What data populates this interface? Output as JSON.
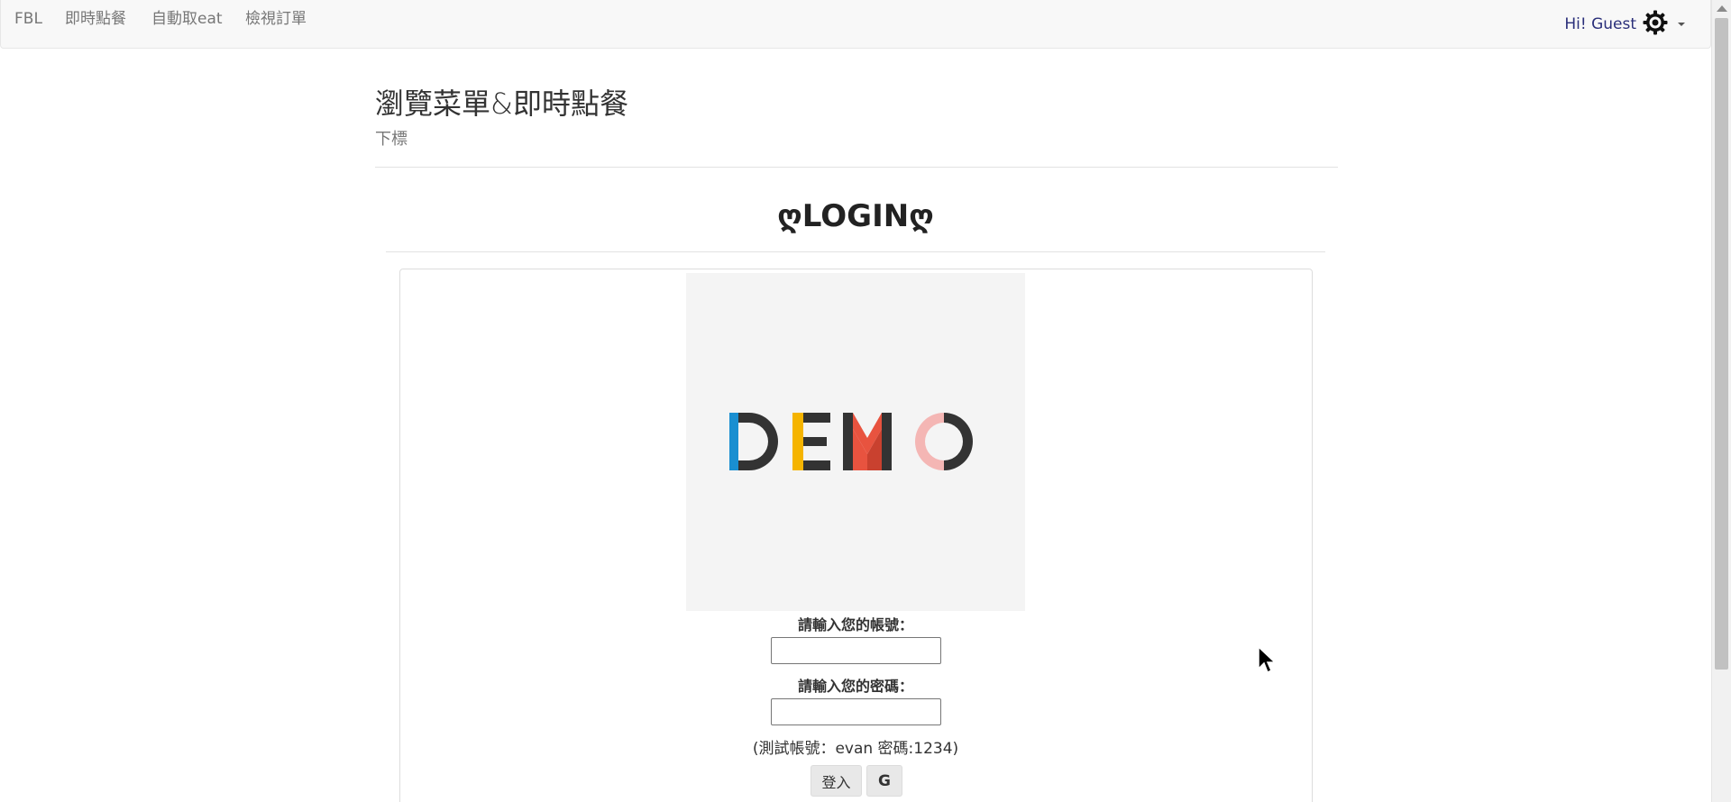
{
  "navbar": {
    "brand": "FBL",
    "links": [
      "即時點餐",
      "自動取eat",
      "檢視訂單"
    ],
    "greeting": "Hi! Guest",
    "menu_icon": "gear-icon"
  },
  "header": {
    "title": "瀏覽菜單&即時點餐",
    "subtitle": "下標"
  },
  "login": {
    "heading": "ღLOGINღ",
    "logo_text": "DEMO",
    "account_label": "請輸入您的帳號：",
    "account_value": "",
    "password_label": "請輸入您的密碼：",
    "password_value": "",
    "test_hint": "(測試帳號：evan 密碼:1234)",
    "login_button": "登入",
    "google_button": "G"
  },
  "colors": {
    "navbar_bg": "#f8f8f8",
    "greeting": "#2a2f7a",
    "logo_d": "#1a8fd1",
    "logo_e": "#f5b400",
    "logo_m": "#e8533f",
    "logo_o": "#f4b6b4",
    "logo_dark": "#333333"
  }
}
